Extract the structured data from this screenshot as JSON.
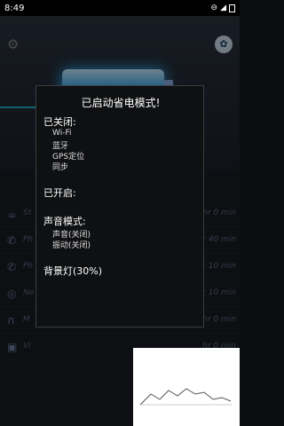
{
  "status_bar": {
    "time": "8:49"
  },
  "dialog": {
    "title": "已启动省电模式!",
    "closed_heading": "已关闭:",
    "closed_items": [
      "Wi-Fi",
      "蓝牙",
      "GPS定位",
      "同步"
    ],
    "opened_heading": "已开启:",
    "sound_heading": "声音模式:",
    "sound_items": [
      "声音(关闭)",
      "振动(关闭)"
    ],
    "backlight": "背景灯(30%)"
  },
  "background_list": [
    {
      "icon": "coffee-icon",
      "label": "St",
      "value": "hr 0 min"
    },
    {
      "icon": "phone-icon",
      "label": "Ph",
      "value": "hr 40 min"
    },
    {
      "icon": "phone-wifi-icon",
      "label": "Ph",
      "value": "hr 10 min"
    },
    {
      "icon": "globe-icon",
      "label": "Ne",
      "value": "hr 10 min"
    },
    {
      "icon": "headphones-icon",
      "label": "M",
      "value": "hr 0 min"
    },
    {
      "icon": "film-icon",
      "label": "Vi",
      "value": "hr 0 min"
    }
  ]
}
